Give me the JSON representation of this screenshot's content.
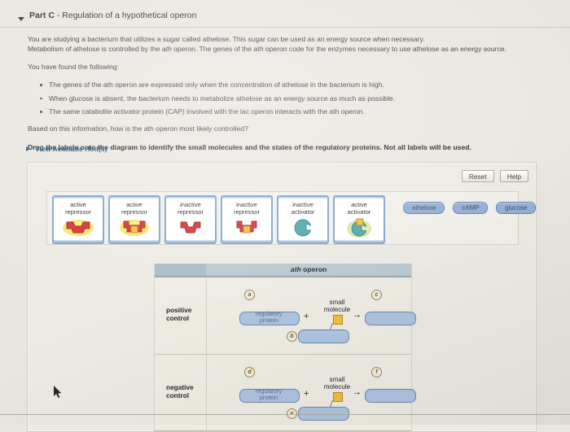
{
  "header": {
    "part": "Part C",
    "separator": " - ",
    "title": "Regulation of a hypothetical operon",
    "disclosure_icon": "triangle-down-icon"
  },
  "prose": {
    "intro_line1": "You are studying a bacterium that utilizes a sugar called athelose. This sugar can be used as an energy source when necessary.",
    "intro_line2_a": "Metabolism of athelose is controlled by the ",
    "intro_line2_italic": "ath",
    "intro_line2_b": " operon. The genes of the ",
    "intro_line2_italic2": "ath",
    "intro_line2_c": " operon code for the enzymes necessary to use athelose as an energy source.",
    "found_heading": "You have found the following:",
    "facts": [
      "The genes of the ath operon are expressed only when the concentration of athelose in the bacterium is high.",
      "When glucose is absent, the bacterium needs to metabolize athelose as an energy source as much as possible.",
      "The same catabolite activator protein (CAP) involved with the lac operon interacts with the ath operon."
    ],
    "question": "Based on this information, how is the ath operon most likely controlled?",
    "directive": "Drag the labels onto the diagram to identify the small molecules and the states of the regulatory proteins. Not all labels will be used."
  },
  "hint": {
    "label": "View Available Hint(s)",
    "icon": "triangle-right-icon"
  },
  "toolbar": {
    "reset_label": "Reset",
    "help_label": "Help"
  },
  "bank": {
    "tiles": [
      {
        "line1": "active",
        "line2": "repressor",
        "art": "repressor-open-glow",
        "shape": "repressor",
        "bound": false,
        "glow": "yellow"
      },
      {
        "line1": "active",
        "line2": "repressor",
        "art": "repressor-bound-glow",
        "shape": "repressor",
        "bound": true,
        "glow": "yellow"
      },
      {
        "line1": "inactive",
        "line2": "repressor",
        "art": "repressor-open",
        "shape": "repressor",
        "bound": false,
        "glow": "none"
      },
      {
        "line1": "inactive",
        "line2": "repressor",
        "art": "repressor-bound",
        "shape": "repressor",
        "bound": true,
        "glow": "none"
      },
      {
        "line1": "inactive",
        "line2": "activator",
        "art": "activator-open",
        "shape": "activator",
        "bound": false,
        "glow": "none"
      },
      {
        "line1": "active",
        "line2": "activator",
        "art": "activator-bound-glow",
        "shape": "activator",
        "bound": true,
        "glow": "green"
      }
    ],
    "chips": [
      "athelose",
      "cAMP",
      "glucose"
    ]
  },
  "diagram": {
    "operon_title_italic": "ath",
    "operon_title_rest": " operon",
    "rows": [
      {
        "name_line1": "positive",
        "name_line2": "control",
        "protein_line1": "regulatory",
        "protein_line2": "protein",
        "plus": "+",
        "small_molecule_line1": "small",
        "small_molecule_line2": "molecule",
        "arrow": "→",
        "markers": {
          "left": "a",
          "bottom": "b",
          "right": "c"
        }
      },
      {
        "name_line1": "negative",
        "name_line2": "control",
        "protein_line1": "regulatory",
        "protein_line2": "protein",
        "plus": "+",
        "small_molecule_line1": "small",
        "small_molecule_line2": "molecule",
        "arrow": "→",
        "markers": {
          "left": "d",
          "bottom": "e",
          "right": "f"
        }
      }
    ]
  },
  "colors": {
    "page_bg": "#e9e6df",
    "panel_bg": "#eceae3",
    "tile_border": "#7ea4cd",
    "chip_fill": "#93aed4",
    "slot_fill": "#aec4e0",
    "header_band": "#b9c9cf",
    "repressor_red": "#d62f2f",
    "activator_teal": "#4aa8a8",
    "molecule_yellow": "#f0bf3c",
    "link_blue": "#1f4d77"
  }
}
